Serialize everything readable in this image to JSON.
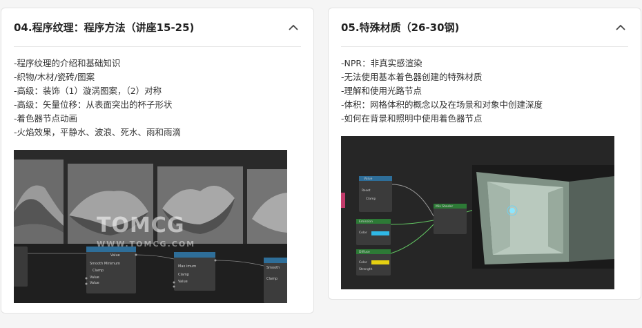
{
  "cards": [
    {
      "title": "04.程序纹理：程序方法（讲座15-25)",
      "items": [
        "-程序纹理的介绍和基础知识",
        "-织物/木材/瓷砖/图案",
        "-高级：装饰（1）漩涡图案，（2）对称",
        "-高级：矢量位移：从表面突出的杯子形状",
        "-着色器节点动画",
        "-火焰效果，平静水、波浪、死水、雨和雨滴"
      ],
      "image": {
        "watermark_title": "TOMCG",
        "watermark_sub": "WWW.TOMCG.COM",
        "node_labels": [
          "Value",
          "Max imum",
          "Smooth Minimum",
          "Clamp",
          "Value",
          "Value"
        ]
      }
    },
    {
      "title": "05.特殊材质（26-30钢)",
      "items": [
        "-NPR：非真实感渲染",
        "-无法使用基本着色器创建的特殊材质",
        "-理解和使用光路节点",
        "-体积：网格体积的概念以及在场景和对象中创建深度",
        "-如何在背景和照明中使用着色器节点"
      ],
      "image": {
        "node_labels": [
          "Value",
          "Mix Shader",
          "Emission",
          "Diffuse",
          "Color",
          "Strength"
        ]
      }
    }
  ],
  "colors": {
    "node_header_blue": "#2e6e99",
    "node_header_green": "#2d7a36",
    "socket_green": "#63c763",
    "color_cyan": "#2fb8e6",
    "color_yellow": "#e5d012"
  }
}
